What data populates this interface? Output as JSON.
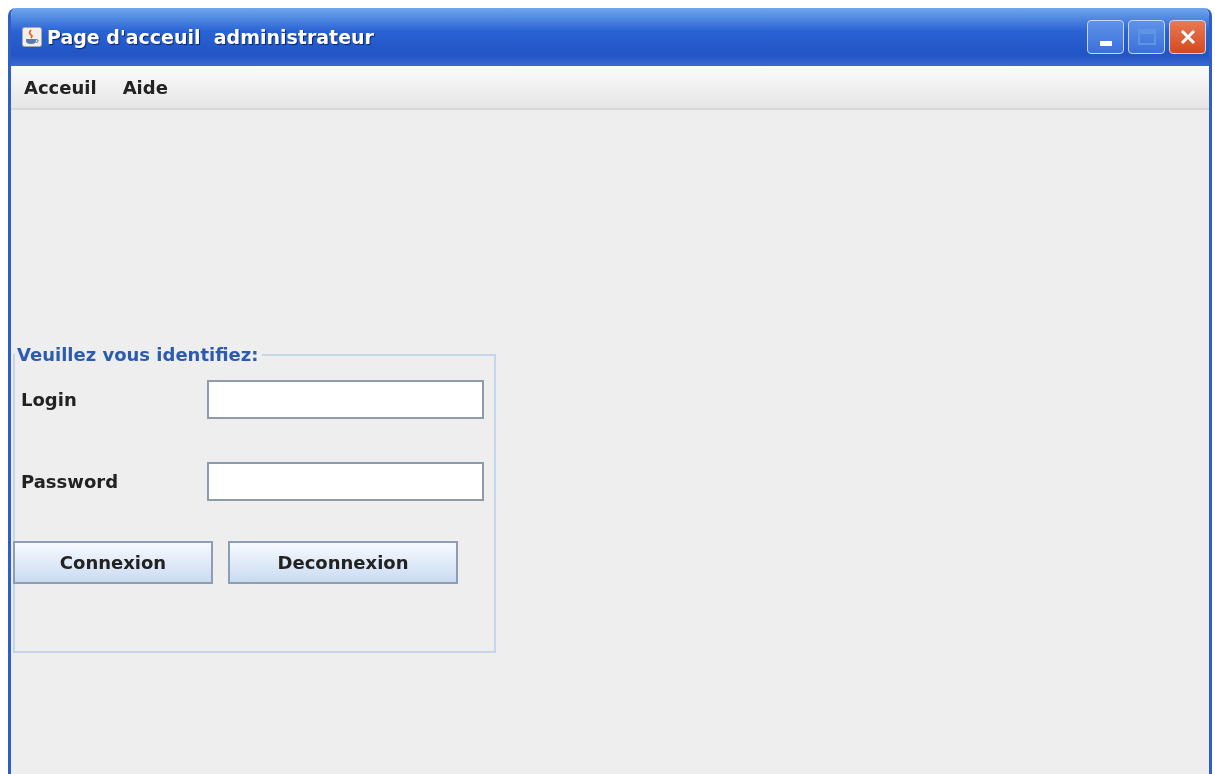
{
  "window": {
    "title": "Page d'acceuil  administrateur"
  },
  "menu": [
    "Acceuil",
    "Aide"
  ],
  "login_panel": {
    "title": "Veuillez vous identifiez:",
    "fields": [
      {
        "label": "Login"
      },
      {
        "label": "Password"
      }
    ],
    "buttons": [
      "Connexion",
      "Deconnexion"
    ]
  }
}
